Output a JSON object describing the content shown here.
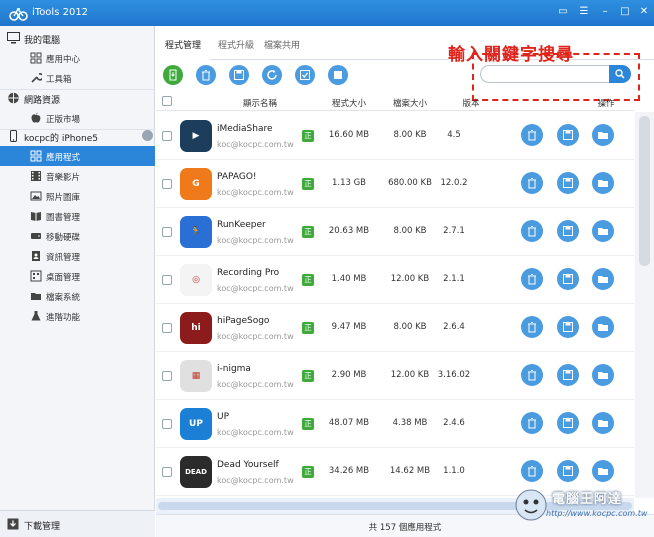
{
  "window": {
    "title": "iTools 2012"
  },
  "sidebar": {
    "sections": [
      {
        "label": "我的電腦",
        "icon": "monitor-icon",
        "items": [
          {
            "label": "應用中心",
            "icon": "grid-icon"
          },
          {
            "label": "工具箱",
            "icon": "wrench-icon"
          }
        ]
      },
      {
        "label": "網路資源",
        "icon": "globe-icon",
        "items": [
          {
            "label": "正版市場",
            "icon": "apple-icon"
          }
        ]
      },
      {
        "label": "kocpc的 iPhone5",
        "icon": "phone-icon",
        "items": [
          {
            "label": "應用程式",
            "icon": "grid-icon"
          },
          {
            "label": "音樂影片",
            "icon": "film-icon"
          },
          {
            "label": "照片圖庫",
            "icon": "photo-icon"
          },
          {
            "label": "圖書管理",
            "icon": "book-icon"
          },
          {
            "label": "移動硬碟",
            "icon": "drive-icon"
          },
          {
            "label": "資訊管理",
            "icon": "contacts-icon"
          },
          {
            "label": "桌面管理",
            "icon": "desktop-icon"
          },
          {
            "label": "檔案系統",
            "icon": "folder-icon"
          },
          {
            "label": "進階功能",
            "icon": "flask-icon"
          }
        ]
      }
    ],
    "active_item": "應用程式",
    "download_label": "下載管理"
  },
  "tabs": [
    {
      "label": "程式管理"
    },
    {
      "label": "程式升級"
    },
    {
      "label": "檔案共用"
    }
  ],
  "annotation": "輸入關鍵字搜尋",
  "toolbar": {
    "buttons": [
      {
        "icon": "install-icon",
        "color": "#3eaa3c"
      },
      {
        "icon": "trash-icon",
        "color": "#4a9be0"
      },
      {
        "icon": "save-icon",
        "color": "#4a9be0"
      },
      {
        "icon": "refresh-icon",
        "color": "#4a9be0"
      },
      {
        "icon": "check-all-icon",
        "color": "#4a9be0"
      },
      {
        "icon": "uncheck-icon",
        "color": "#4a9be0"
      }
    ]
  },
  "search": {
    "placeholder": "",
    "value": ""
  },
  "table": {
    "headers": {
      "name": "顯示名稱",
      "app_size": "程式大小",
      "doc_size": "檔案大小",
      "version": "版本",
      "ops": "操作"
    },
    "rows": [
      {
        "name": "iMediaShare",
        "publisher": "koc@kocpc.com.tw",
        "badge": "正",
        "app_size": "16.60 MB",
        "doc_size": "8.00 KB",
        "version": "4.5",
        "icon_text": "▶",
        "icon_bg": "#1d3d5c"
      },
      {
        "name": "PAPAGO!",
        "publisher": "koc@kocpc.com.tw",
        "badge": "正",
        "app_size": "1.13 GB",
        "doc_size": "680.00 KB",
        "version": "12.0.2",
        "icon_text": "G",
        "icon_bg": "#f07a1a"
      },
      {
        "name": "RunKeeper",
        "publisher": "koc@kocpc.com.tw",
        "badge": "正",
        "app_size": "20.63 MB",
        "doc_size": "8.00 KB",
        "version": "2.7.1",
        "icon_text": "🏃",
        "icon_bg": "#2a6fd4"
      },
      {
        "name": "Recording Pro",
        "publisher": "koc@kocpc.com.tw",
        "badge": "正",
        "app_size": "1.40 MB",
        "doc_size": "12.00 KB",
        "version": "2.1.1",
        "icon_text": "◎",
        "icon_bg": "#f4f4f4"
      },
      {
        "name": "hiPageSogo",
        "publisher": "koc@kocpc.com.tw",
        "badge": "正",
        "app_size": "9.47 MB",
        "doc_size": "8.00 KB",
        "version": "2.6.4",
        "icon_text": "hi",
        "icon_bg": "#8c1c1c"
      },
      {
        "name": "i-nigma",
        "publisher": "koc@kocpc.com.tw",
        "badge": "正",
        "app_size": "2.90 MB",
        "doc_size": "12.00 KB",
        "version": "3.16.02",
        "icon_text": "▦",
        "icon_bg": "#e0e0e0"
      },
      {
        "name": "UP",
        "publisher": "koc@kocpc.com.tw",
        "badge": "正",
        "app_size": "48.07 MB",
        "doc_size": "4.38 MB",
        "version": "2.4.6",
        "icon_text": "UP",
        "icon_bg": "#1b7fd6"
      },
      {
        "name": "Dead Yourself",
        "publisher": "koc@kocpc.com.tw",
        "badge": "正",
        "app_size": "34.26 MB",
        "doc_size": "14.62 MB",
        "version": "1.1.0",
        "icon_text": "DEAD",
        "icon_bg": "#2b2b2b"
      }
    ]
  },
  "footer": {
    "summary": "共 157 個應用程式"
  },
  "watermark": {
    "line1": "電腦王阿達",
    "line2": "http://www.kocpc.com.tw"
  }
}
